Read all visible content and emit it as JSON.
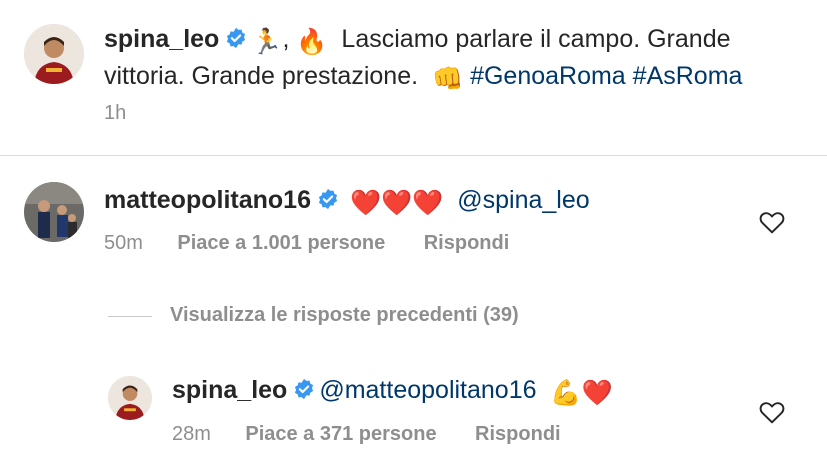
{
  "caption": {
    "username": "spina_leo",
    "emoji_1": "🏃",
    "emoji_2": "🔥",
    "line1_text": "Lasciamo parlare il campo. Grande",
    "line2_text": "vittoria. Grande prestazione.",
    "emoji_3": "👊",
    "hashtags": "#GenoaRoma #AsRoma",
    "time": "1h"
  },
  "comment1": {
    "username": "matteopolitano16",
    "hearts": "❤️❤️❤️",
    "mention": "@spina_leo",
    "time": "50m",
    "likes": "Piace a 1.001 persone",
    "reply": "Rispondi"
  },
  "view_replies": "Visualizza le risposte precedenti (39)",
  "reply1": {
    "username": "spina_leo",
    "mention": "@matteopolitano16",
    "emojis": "💪❤️",
    "time": "28m",
    "likes": "Piace a 371 persone",
    "reply": "Rispondi"
  },
  "colors": {
    "text": "#262626",
    "muted": "#8e8e8e",
    "link": "#00376b",
    "verified": "#3897f0",
    "divider": "#dbdbdb",
    "heart": "#ed1c24"
  }
}
